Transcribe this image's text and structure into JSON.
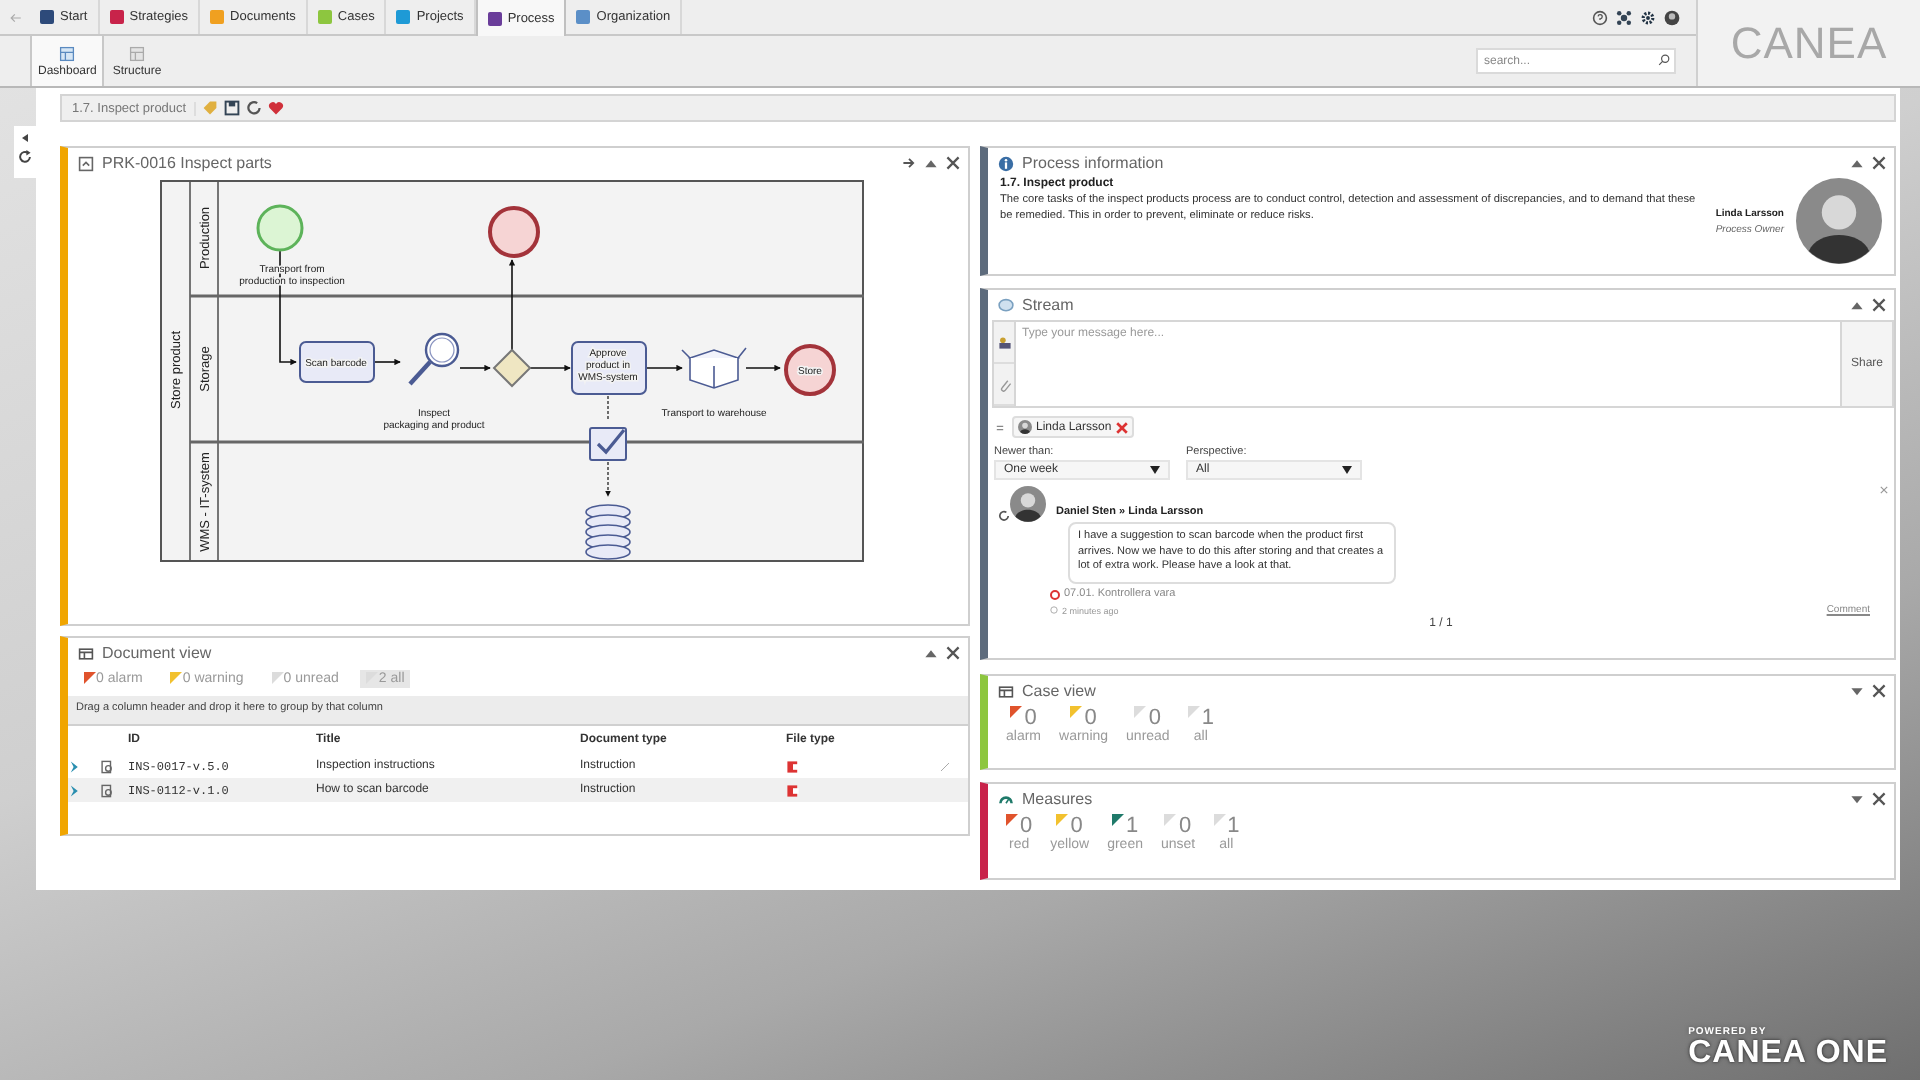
{
  "top_tabs": [
    {
      "label": "Start",
      "selected": false,
      "color": "#2d4a7a"
    },
    {
      "label": "Strategies",
      "selected": false,
      "color": "#c8234a"
    },
    {
      "label": "Documents",
      "selected": false,
      "color": "#f0a020"
    },
    {
      "label": "Cases",
      "selected": false,
      "color": "#8dc63f"
    },
    {
      "label": "Projects",
      "selected": false,
      "color": "#1e9ad6"
    },
    {
      "label": "Process",
      "selected": true,
      "color": "#6a3d9a"
    },
    {
      "label": "Organization",
      "selected": false,
      "color": "#5b8fc7"
    }
  ],
  "sub_tabs": [
    {
      "label": "Dashboard",
      "selected": true
    },
    {
      "label": "Structure",
      "selected": false
    }
  ],
  "search": {
    "placeholder": "search..."
  },
  "logo": "CANEA",
  "breadcrumb": "1.7. Inspect product",
  "diagram_panel": {
    "title": "PRK-0016 Inspect parts",
    "pool": "Store product",
    "lanes": [
      "Production",
      "Storage",
      "WMS - IT-system"
    ],
    "nodes": [
      {
        "kind": "start",
        "lines": [
          "Transport from",
          "production to inspection"
        ]
      },
      {
        "kind": "end"
      },
      {
        "kind": "task",
        "lines": [
          "Scan barcode"
        ]
      },
      {
        "kind": "inspect",
        "lines": [
          "Inspect",
          "packaging and product"
        ]
      },
      {
        "kind": "gateway"
      },
      {
        "kind": "task",
        "lines": [
          "Approve",
          "product in",
          "WMS-system"
        ]
      },
      {
        "kind": "transport",
        "lines": [
          "Transport to warehouse"
        ]
      },
      {
        "kind": "end",
        "lines": [
          "Store"
        ]
      },
      {
        "kind": "check"
      },
      {
        "kind": "database"
      }
    ]
  },
  "document_view": {
    "title": "Document view",
    "counters": [
      {
        "count": "0",
        "label": "alarm",
        "color": "#e0532c",
        "selected": false
      },
      {
        "count": "0",
        "label": "warning",
        "color": "#f2c12e",
        "selected": false
      },
      {
        "count": "0",
        "label": "unread",
        "color": "#dcdcdc",
        "selected": false
      },
      {
        "count": "2",
        "label": "all",
        "color": "#dcdcdc",
        "selected": true
      }
    ],
    "group_hint": "Drag a column header and drop it here to group by that column",
    "columns": [
      "ID",
      "Title",
      "Document type",
      "File type"
    ],
    "rows": [
      {
        "id": "INS-0017-v.5.0",
        "title": "Inspection instructions",
        "type": "Instruction"
      },
      {
        "id": "INS-0112-v.1.0",
        "title": "How to scan barcode",
        "type": "Instruction"
      }
    ]
  },
  "process_info": {
    "title": "Process information",
    "heading": "1.7. Inspect product",
    "description": "The core tasks of the inspect products process are to conduct control, detection and assessment of discrepancies, and to demand that these be remedied. This in order to prevent, eliminate or reduce risks.",
    "owner_name": "Linda Larsson",
    "owner_role": "Process Owner"
  },
  "stream": {
    "title": "Stream",
    "placeholder": "Type your message here...",
    "share": "Share",
    "chip": "Linda Larsson",
    "filters": [
      {
        "label": "Newer than:",
        "value": "One week"
      },
      {
        "label": "Perspective:",
        "value": "All"
      }
    ],
    "post": {
      "author": "Daniel Sten » Linda Larsson",
      "text": "I have a suggestion to scan barcode when the product first arrives. Now we have to do this after storing and that creates a lot of extra work. Please have a look at that.",
      "link": "07.01. Kontrollera vara",
      "time": "2 minutes ago",
      "action": "Comment"
    },
    "pager": "1 / 1"
  },
  "case_view": {
    "title": "Case view",
    "counters": [
      {
        "count": "0",
        "label": "alarm",
        "color": "#e0532c"
      },
      {
        "count": "0",
        "label": "warning",
        "color": "#f2c12e"
      },
      {
        "count": "0",
        "label": "unread",
        "color": "#dcdcdc"
      },
      {
        "count": "1",
        "label": "all",
        "color": "#dcdcdc"
      }
    ]
  },
  "measures": {
    "title": "Measures",
    "counters": [
      {
        "count": "0",
        "label": "red",
        "color": "#e0532c"
      },
      {
        "count": "0",
        "label": "yellow",
        "color": "#f2c12e"
      },
      {
        "count": "1",
        "label": "green",
        "color": "#1f7a6a"
      },
      {
        "count": "0",
        "label": "unset",
        "color": "#dcdcdc"
      },
      {
        "count": "1",
        "label": "all",
        "color": "#dcdcdc"
      }
    ]
  },
  "footer": {
    "powered_by": "POWERED BY",
    "brand": "CANEA ONE"
  }
}
